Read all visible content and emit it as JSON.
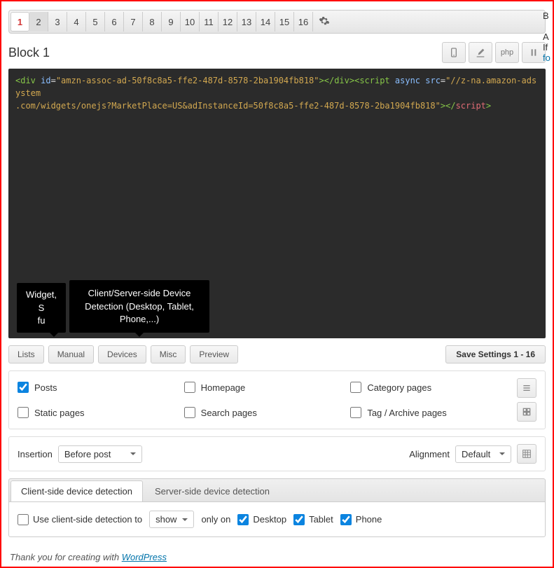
{
  "tabs": [
    "1",
    "2",
    "3",
    "4",
    "5",
    "6",
    "7",
    "8",
    "9",
    "10",
    "11",
    "12",
    "13",
    "14",
    "15",
    "16"
  ],
  "block_title": "Block 1",
  "header_buttons": {
    "php": "php"
  },
  "code": {
    "l1a": "<div",
    "l1b": " id",
    "l1c": "=",
    "l1d": "\"amzn-assoc-ad-50f8c8a5-ffe2-487d-8578-2ba1904fb818\"",
    "l1e": "></div><script",
    "l1f": " async src",
    "l1g": "=",
    "l1h": "\"//z-na.amazon-adsystem",
    "l2a": ".com/widgets/onejs?MarketPlace=US&adInstanceId=50f8c8a5-ffe2-487d-8578-2ba1904fb818\"",
    "l2b": "></",
    "l2c": "script",
    "l2d": ">"
  },
  "tooltips": {
    "manual": "Widget, Shortcode and PHP function call",
    "manual_short1": "Widget, S",
    "manual_short2": "fu",
    "devices": "Client/Server-side Device Detection (Desktop, Tablet, Phone,...)"
  },
  "option_buttons": {
    "lists": "Lists",
    "manual": "Manual",
    "devices": "Devices",
    "misc": "Misc",
    "preview": "Preview"
  },
  "save_button": "Save Settings 1 - 16",
  "checks": {
    "posts": "Posts",
    "homepage": "Homepage",
    "category": "Category pages",
    "static": "Static pages",
    "search": "Search pages",
    "tag": "Tag / Archive pages"
  },
  "insertion": {
    "label": "Insertion",
    "value": "Before post"
  },
  "alignment": {
    "label": "Alignment",
    "value": "Default"
  },
  "detection": {
    "tab_client": "Client-side device detection",
    "tab_server": "Server-side device detection",
    "use_label_pre": "Use client-side detection to",
    "select_value": "show",
    "use_label_post": "only on",
    "desktop": "Desktop",
    "tablet": "Tablet",
    "phone": "Phone"
  },
  "side": {
    "l1": "B",
    "l2": "A",
    "l3": "If",
    "l4": "fo"
  },
  "footer": {
    "pre": "Thank you for creating with ",
    "link": "WordPress"
  }
}
